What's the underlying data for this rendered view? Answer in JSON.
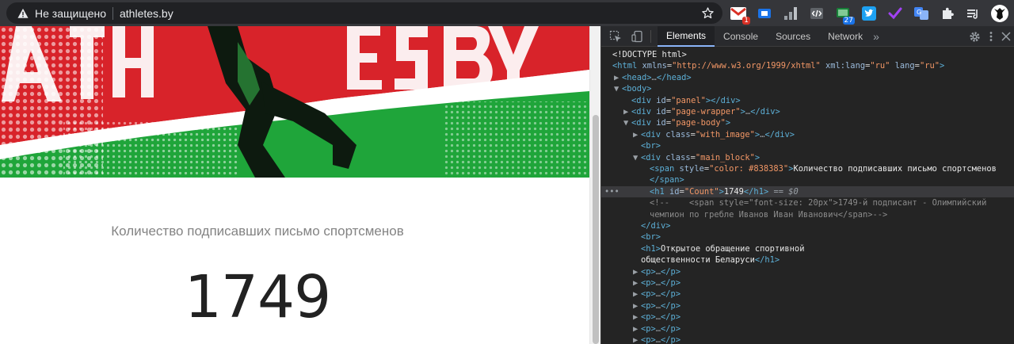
{
  "browser": {
    "security_label": "Не защищено",
    "url": "athletes.by",
    "extensions": [
      {
        "name": "gmail-extension-icon",
        "badge": "1",
        "badge_color": "#d93025"
      },
      {
        "name": "blue-extension-icon",
        "badge": "",
        "badge_color": ""
      },
      {
        "name": "signal-bars-icon",
        "badge": "",
        "badge_color": ""
      },
      {
        "name": "code-extension-icon",
        "badge": "",
        "badge_color": ""
      },
      {
        "name": "screen-extension-icon",
        "badge": "27",
        "badge_color": "#1a73e8"
      },
      {
        "name": "twitter-icon",
        "badge": "",
        "badge_color": ""
      },
      {
        "name": "check-extension-icon",
        "badge": "",
        "badge_color": ""
      },
      {
        "name": "translate-icon",
        "badge": "",
        "badge_color": ""
      },
      {
        "name": "puzzle-icon",
        "badge": "",
        "badge_color": ""
      },
      {
        "name": "playlist-icon",
        "badge": "",
        "badge_color": ""
      },
      {
        "name": "profile-avatar",
        "badge": "",
        "badge_color": ""
      }
    ]
  },
  "page": {
    "hero_text": "ATHLETESBY",
    "subtitle": "Количество подписавших письмо спортсменов",
    "count": "1749",
    "colors": {
      "flag_red": "#d8232a",
      "flag_green": "#1fa53a",
      "flag_white": "#ffffff",
      "subtitle": "#838383"
    }
  },
  "devtools": {
    "tabs": [
      "Elements",
      "Console",
      "Sources",
      "Network"
    ],
    "active_tab": "Elements",
    "more_tabs": "»"
  }
}
